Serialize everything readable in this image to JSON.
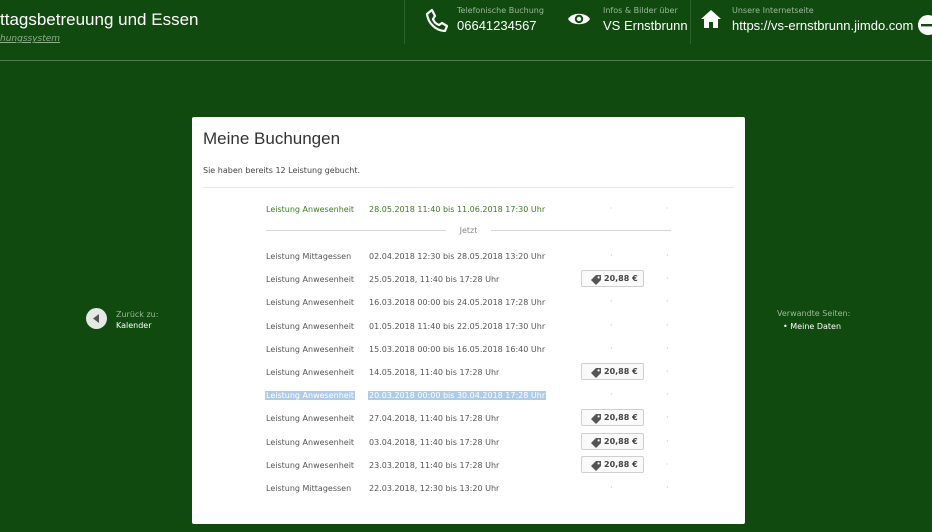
{
  "header": {
    "title": "ttagsbetreuung und Essen",
    "subtitle": "hungssystem",
    "phone": {
      "label": "Telefonische Buchung",
      "value": "06641234567",
      "icon": "phone-icon"
    },
    "info": {
      "label": "Infos & Bilder über",
      "value": "VS Ernstbrunn",
      "icon": "eye-icon"
    },
    "web": {
      "label": "Unsere Internetseite",
      "value": "https://vs-ernstbrunn.jimdo.com",
      "icon": "home-icon"
    }
  },
  "nav": {
    "back_small": "Zurück zu:",
    "back_big": "Kalender",
    "related_title": "Verwandte Seiten:",
    "related_item": "Meine Daten"
  },
  "card": {
    "title": "Meine Buchungen",
    "summary": "Sie haben bereits 12 Leistung gebucht.",
    "separator": "Jetzt",
    "current": {
      "service": "Leistung Anwesenheit",
      "range": "28.05.2018 11:40 bis 11.06.2018 17:30 Uhr",
      "price": "",
      "dot1": "·",
      "dot2": "·"
    },
    "rows": [
      {
        "service": "Leistung Mittagessen",
        "range": "02.04.2018 12:30 bis 28.05.2018 13:20 Uhr",
        "price": "",
        "dot1": "·",
        "dot2": "·"
      },
      {
        "service": "Leistung Anwesenheit",
        "range": "25.05.2018, 11:40 bis 17:28 Uhr",
        "price": "20,88 €",
        "dot1": "",
        "dot2": "·"
      },
      {
        "service": "Leistung Anwesenheit",
        "range": "16.03.2018 00:00 bis 24.05.2018 17:28 Uhr",
        "price": "",
        "dot1": "·",
        "dot2": "·"
      },
      {
        "service": "Leistung Anwesenheit",
        "range": "01.05.2018 11:40 bis 22.05.2018 17:30 Uhr",
        "price": "",
        "dot1": "·",
        "dot2": "·"
      },
      {
        "service": "Leistung Anwesenheit",
        "range": "15.03.2018 00:00 bis 16.05.2018 16:40 Uhr",
        "price": "",
        "dot1": "·",
        "dot2": "·"
      },
      {
        "service": "Leistung Anwesenheit",
        "range": "14.05.2018, 11:40 bis 17:28 Uhr",
        "price": "20,88 €",
        "dot1": "",
        "dot2": "·"
      },
      {
        "service": "Leistung Anwesenheit",
        "range": "20.03.2018 00:00 bis 30.04.2018 17:28 Uhr",
        "price": "",
        "dot1": "·",
        "dot2": "·",
        "selected": true
      },
      {
        "service": "Leistung Anwesenheit",
        "range": "27.04.2018, 11:40 bis 17:28 Uhr",
        "price": "20,88 €",
        "dot1": "",
        "dot2": "·"
      },
      {
        "service": "Leistung Anwesenheit",
        "range": "03.04.2018, 11:40 bis 17:28 Uhr",
        "price": "20,88 €",
        "dot1": "",
        "dot2": "·"
      },
      {
        "service": "Leistung Anwesenheit",
        "range": "23.03.2018, 11:40 bis 17:28 Uhr",
        "price": "20,88 €",
        "dot1": "",
        "dot2": "·"
      },
      {
        "service": "Leistung Mittagessen",
        "range": "22.03.2018, 12:30 bis 13:20 Uhr",
        "price": "",
        "dot1": "·",
        "dot2": "·"
      }
    ]
  },
  "colors": {
    "background": "#104a0f",
    "current_text": "#3b7a23",
    "selection": "#aecbe8"
  }
}
